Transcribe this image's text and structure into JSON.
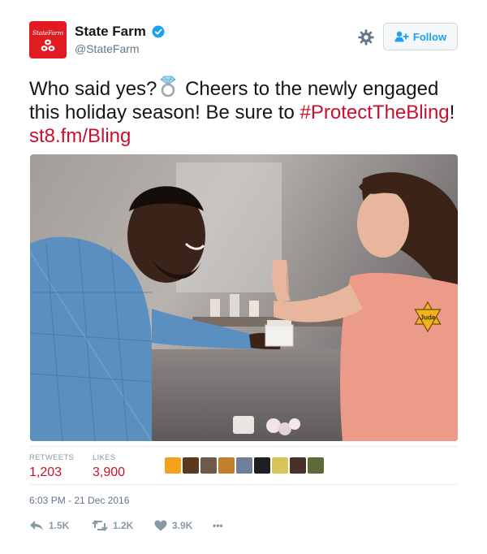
{
  "account": {
    "display_name": "State Farm",
    "handle": "@StateFarm",
    "avatar_text": "StateFarm",
    "verified": true
  },
  "follow_button": {
    "label": "Follow"
  },
  "tweet": {
    "text_part1": "Who said yes?",
    "text_part2": " Cheers to the newly engaged this holiday season! Be sure to ",
    "hashtag": "#ProtectTheBling",
    "text_part3": "! ",
    "link": "st8.fm/Bling",
    "emoji": "ring",
    "image_badge_text": "Jude"
  },
  "stats": {
    "retweets_label": "RETWEETS",
    "retweets_value": "1,203",
    "likes_label": "LIKES",
    "likes_value": "3,900"
  },
  "timestamp": "6:03 PM - 21 Dec 2016",
  "actions": {
    "reply_count": "1.5K",
    "retweet_count": "1.2K",
    "like_count": "3.9K",
    "more_label": "•••"
  },
  "colors": {
    "brand_red": "#e01b22",
    "link_red": "#c8102e",
    "twitter_blue": "#1da1f2",
    "muted": "#8899a6"
  }
}
